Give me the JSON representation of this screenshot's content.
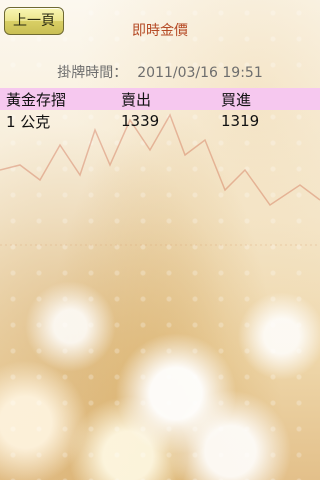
{
  "nav": {
    "back_label": "上一頁",
    "title": "即時金價"
  },
  "quote_time": {
    "label": "掛牌時間：",
    "value": "2011/03/16 19:51"
  },
  "table": {
    "headers": [
      "黃金存摺",
      "賣出",
      "買進"
    ],
    "rows": [
      [
        "1 公克",
        "1339",
        "1319"
      ]
    ]
  },
  "colors": {
    "title": "#b54a25",
    "header_bg": "#f6c8ef",
    "button": "#ebe48d"
  }
}
